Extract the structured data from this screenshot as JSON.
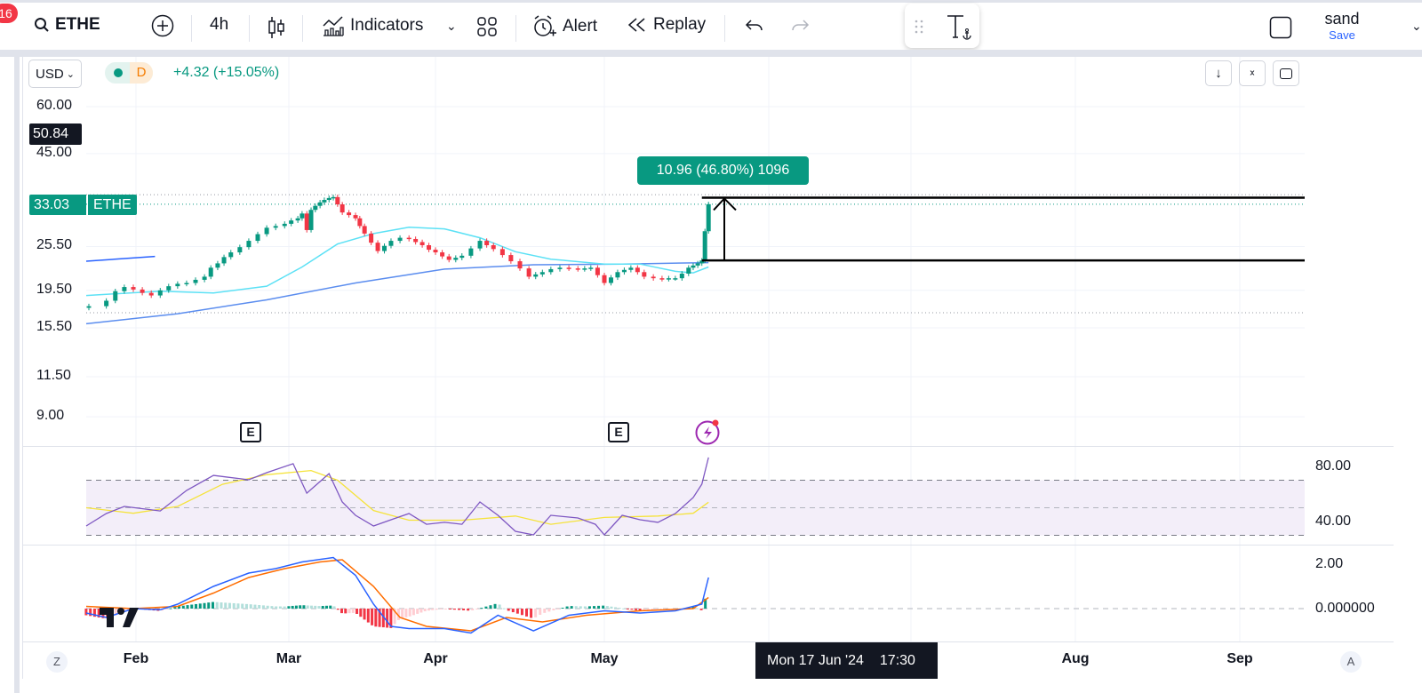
{
  "toolbar": {
    "notification_count": "16",
    "symbol": "ETHE",
    "interval": "4h",
    "indicators_label": "Indicators",
    "alert_label": "Alert",
    "replay_label": "Replay",
    "layout_name": "sand",
    "save_label": "Save"
  },
  "legend": {
    "currency": "USD",
    "data_badge": "D",
    "change": "+4.32 (+15.05%)"
  },
  "price_axis": {
    "ticks": [
      "60.00",
      "45.00",
      "25.50",
      "19.50",
      "15.50",
      "11.50",
      "9.00"
    ],
    "crosshair_price": "50.84",
    "last_price": "33.03",
    "last_price_symbol": "ETHE"
  },
  "rsi_axis": {
    "ticks": [
      "80.00",
      "40.00"
    ]
  },
  "macd_axis": {
    "ticks": [
      "2.00",
      "0.000000"
    ]
  },
  "time_axis": {
    "labels": [
      "Feb",
      "Mar",
      "Apr",
      "May",
      "Aug",
      "Sep"
    ],
    "crosshair_date": "Mon 17 Jun '24",
    "crosshair_time": "17:30",
    "left_button": "Z",
    "right_button": "A"
  },
  "events": {
    "earnings_label": "E"
  },
  "colors": {
    "up": "#089981",
    "down": "#f23645",
    "ma_fast": "#5ce1f5",
    "ma_slow": "#5b8def",
    "rsi": "#7e57c2",
    "rsi_ma": "#f5e33b",
    "macd": "#2962ff",
    "signal": "#ff6d00",
    "accent": "#2962ff"
  },
  "chart_data": {
    "type": "candlestick",
    "x_unit": "day of year 2024",
    "price_scale": "log",
    "ylim": [
      9,
      60
    ],
    "candles_close": [
      [
        22.1,
        17.7
      ],
      [
        25.4,
        18.3
      ],
      [
        27.1,
        19.4
      ],
      [
        28.8,
        19.9
      ],
      [
        30.5,
        19.6
      ],
      [
        32.2,
        19.2
      ],
      [
        33.9,
        18.9
      ],
      [
        35.6,
        19.5
      ],
      [
        37.2,
        20.0
      ],
      [
        38.9,
        20.3
      ],
      [
        40.6,
        20.4
      ],
      [
        42.3,
        20.8
      ],
      [
        44,
        21.2
      ],
      [
        45.2,
        22.4
      ],
      [
        46.5,
        23.0
      ],
      [
        47.7,
        23.9
      ],
      [
        49,
        24.6
      ],
      [
        50.7,
        25.4
      ],
      [
        52.4,
        26.4
      ],
      [
        54.1,
        27.5
      ],
      [
        55.8,
        28.6
      ],
      [
        57.5,
        28.9
      ],
      [
        59.2,
        29.3
      ],
      [
        60.5,
        29.9
      ],
      [
        61.9,
        30.3
      ],
      [
        62.8,
        31.2
      ],
      [
        63.8,
        28.2
      ],
      [
        64.7,
        31.9
      ],
      [
        65.6,
        32.7
      ],
      [
        66.6,
        33.4
      ],
      [
        67.5,
        33.9
      ],
      [
        68.5,
        34.3
      ],
      [
        69.4,
        34.5
      ],
      [
        70.3,
        33.0
      ],
      [
        71.3,
        31.4
      ],
      [
        72.7,
        30.9
      ],
      [
        74.1,
        30.3
      ],
      [
        75,
        28.9
      ],
      [
        76,
        27.6
      ],
      [
        77.4,
        26.1
      ],
      [
        78.8,
        24.8
      ],
      [
        80.2,
        25.6
      ],
      [
        81.6,
        26.4
      ],
      [
        83.5,
        26.9
      ],
      [
        85.4,
        26.7
      ],
      [
        86.8,
        26.2
      ],
      [
        88.2,
        25.7
      ],
      [
        89.6,
        25.0
      ],
      [
        91,
        24.6
      ],
      [
        92.2,
        24.0
      ],
      [
        93.4,
        23.5
      ],
      [
        94.6,
        23.8
      ],
      [
        95.7,
        24.1
      ],
      [
        97.3,
        25.2
      ],
      [
        98.9,
        26.4
      ],
      [
        100.1,
        25.7
      ],
      [
        101.3,
        25.1
      ],
      [
        102.9,
        24.2
      ],
      [
        104.4,
        23.3
      ],
      [
        106,
        22.3
      ],
      [
        107.6,
        21.2
      ],
      [
        108.8,
        21.5
      ],
      [
        110,
        21.8
      ],
      [
        111.5,
        22.2
      ],
      [
        113.1,
        22.4
      ],
      [
        114.7,
        22.3
      ],
      [
        116.3,
        22.2
      ],
      [
        117.5,
        22.3
      ],
      [
        118.6,
        22.4
      ],
      [
        119.8,
        21.4
      ],
      [
        121,
        20.4
      ],
      [
        122.3,
        21.1
      ],
      [
        123.6,
        21.8
      ],
      [
        124.9,
        22.1
      ],
      [
        126.2,
        22.4
      ],
      [
        127.5,
        21.8
      ],
      [
        128.8,
        21.2
      ],
      [
        130.6,
        21.0
      ],
      [
        132.3,
        20.9
      ],
      [
        133.6,
        21.0
      ],
      [
        134.9,
        21.0
      ],
      [
        136.2,
        21.6
      ],
      [
        137.5,
        22.4
      ],
      [
        138.4,
        22.7
      ],
      [
        139.3,
        23.0
      ],
      [
        140.1,
        23.4
      ],
      [
        140.7,
        28.0
      ],
      [
        141.4,
        33.03
      ]
    ],
    "ma_fast": [
      [
        21.6,
        18.9
      ],
      [
        35.6,
        19.4
      ],
      [
        45.7,
        19.2
      ],
      [
        55.8,
        20.0
      ],
      [
        62.8,
        22.5
      ],
      [
        70.3,
        25.9
      ],
      [
        77.9,
        27.6
      ],
      [
        85.4,
        28.7
      ],
      [
        92.6,
        28.4
      ],
      [
        98.9,
        26.9
      ],
      [
        105.2,
        24.7
      ],
      [
        111.5,
        23.6
      ],
      [
        121,
        22.9
      ],
      [
        128,
        22.9
      ],
      [
        134.9,
        21.9
      ],
      [
        138.4,
        21.7
      ],
      [
        141.4,
        22.5
      ]
    ],
    "ma_slow": [
      [
        21.6,
        15.9
      ],
      [
        38.9,
        16.9
      ],
      [
        55.8,
        18.4
      ],
      [
        74.1,
        20.4
      ],
      [
        92.6,
        22.2
      ],
      [
        108.4,
        22.8
      ],
      [
        124.5,
        22.9
      ],
      [
        141.4,
        23.1
      ]
    ],
    "ma_short_segment": [
      [
        21.6,
        23.3
      ],
      [
        34.6,
        24.0
      ]
    ],
    "range_high": 35.0,
    "range_low": 17.0,
    "measure": {
      "from_day": 140.1,
      "from": 23.42,
      "to": 34.38,
      "label": "10.96 (46.80%) 1096"
    },
    "earnings_days": [
      52.0,
      123.0
    ],
    "rsi": {
      "ylim": [
        20,
        100
      ],
      "bands": [
        30,
        50,
        70
      ],
      "values": [
        [
          21.6,
          36.8
        ],
        [
          25.4,
          45.8
        ],
        [
          28.8,
          51
        ],
        [
          35.6,
          47.7
        ],
        [
          40.6,
          62.6
        ],
        [
          45.7,
          73.5
        ],
        [
          52.4,
          70.3
        ],
        [
          55.8,
          75.5
        ],
        [
          60.9,
          82
        ],
        [
          63.8,
          60.6
        ],
        [
          68.5,
          74.8
        ],
        [
          71.3,
          54.2
        ],
        [
          74.1,
          44.5
        ],
        [
          77.9,
          36.8
        ],
        [
          81.6,
          41.3
        ],
        [
          85.4,
          45.8
        ],
        [
          89.1,
          38
        ],
        [
          92.6,
          39.4
        ],
        [
          95.7,
          38
        ],
        [
          98.9,
          54.2
        ],
        [
          102.1,
          44.5
        ],
        [
          105.2,
          32.9
        ],
        [
          108.4,
          30.3
        ],
        [
          111.5,
          44.5
        ],
        [
          116.3,
          42.6
        ],
        [
          119.4,
          38
        ],
        [
          121,
          30.3
        ],
        [
          124.5,
          44.5
        ],
        [
          128,
          41.3
        ],
        [
          131.5,
          39.4
        ],
        [
          134.9,
          45.8
        ],
        [
          138.4,
          57.4
        ],
        [
          140.1,
          67.1
        ],
        [
          141.4,
          86.5
        ]
      ],
      "ma": [
        [
          21.6,
          50
        ],
        [
          30.5,
          46
        ],
        [
          38.9,
          51
        ],
        [
          47.4,
          67
        ],
        [
          55.8,
          74
        ],
        [
          64.7,
          77
        ],
        [
          70.3,
          70
        ],
        [
          77.9,
          48
        ],
        [
          85.4,
          41
        ],
        [
          95.7,
          41
        ],
        [
          105.2,
          44
        ],
        [
          111.5,
          38
        ],
        [
          121,
          43
        ],
        [
          131.5,
          44
        ],
        [
          138.4,
          46
        ],
        [
          141.4,
          54
        ]
      ]
    },
    "macd": {
      "ylim": [
        -1.5,
        2.8
      ],
      "macd": [
        [
          21.6,
          -0.2
        ],
        [
          25.4,
          -0.4
        ],
        [
          30.5,
          0
        ],
        [
          35.6,
          -0.05
        ],
        [
          38.9,
          0.2
        ],
        [
          45.7,
          1.0
        ],
        [
          52.4,
          1.6
        ],
        [
          57.5,
          1.8
        ],
        [
          62.8,
          2.1
        ],
        [
          69.4,
          2.3
        ],
        [
          74.1,
          1.5
        ],
        [
          77.9,
          0.2
        ],
        [
          81.6,
          -0.8
        ],
        [
          85.4,
          -0.9
        ],
        [
          92.6,
          -0.9
        ],
        [
          97.3,
          -1.1
        ],
        [
          102.1,
          -0.3
        ],
        [
          108.4,
          -1.0
        ],
        [
          114.7,
          -0.3
        ],
        [
          121,
          -0.1
        ],
        [
          128,
          -0.2
        ],
        [
          134.9,
          -0.1
        ],
        [
          140.1,
          0.2
        ],
        [
          141.4,
          1.4
        ]
      ],
      "signal": [
        [
          21.6,
          0.1
        ],
        [
          30.5,
          0
        ],
        [
          38.9,
          0.1
        ],
        [
          45.7,
          0.7
        ],
        [
          52.4,
          1.4
        ],
        [
          59.2,
          1.8
        ],
        [
          66.6,
          2.1
        ],
        [
          71.3,
          2.2
        ],
        [
          77.9,
          1.0
        ],
        [
          83.5,
          -0.4
        ],
        [
          89.1,
          -0.8
        ],
        [
          97.3,
          -1.0
        ],
        [
          103.6,
          -0.4
        ],
        [
          110,
          -0.6
        ],
        [
          117.8,
          -0.3
        ],
        [
          128,
          -0.1
        ],
        [
          138.4,
          0
        ],
        [
          141.4,
          0.5
        ]
      ]
    }
  }
}
